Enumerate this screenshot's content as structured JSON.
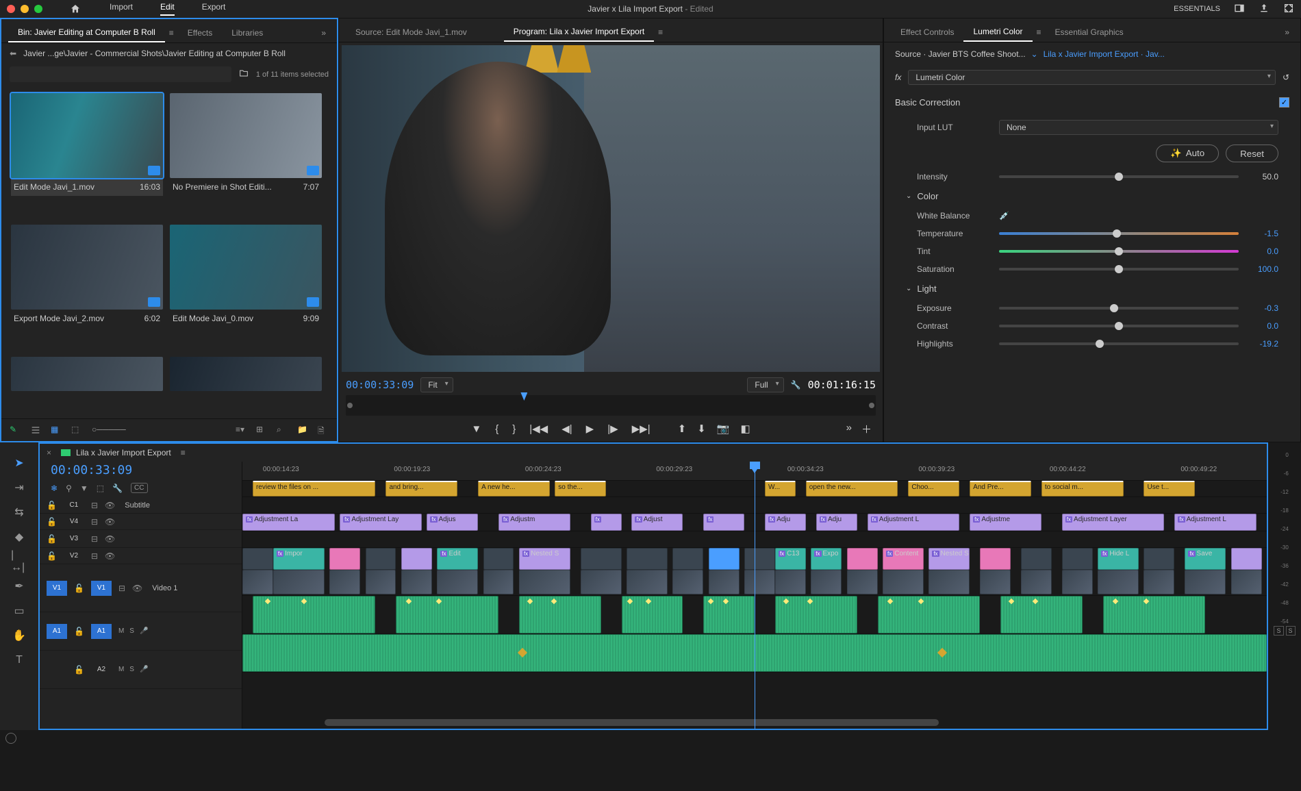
{
  "app": {
    "title": "Javier x Lila Import Export",
    "title_suffix": " - Edited",
    "modes": [
      "Import",
      "Edit",
      "Export"
    ],
    "active_mode": "Edit",
    "workspace": "ESSENTIALS"
  },
  "project": {
    "bin_tab": "Bin: Javier Editing at Computer B Roll",
    "tabs": [
      "Effects",
      "Libraries"
    ],
    "breadcrumb": "Javier ...ge\\Javier - Commercial Shots\\Javier Editing at Computer B Roll",
    "search_placeholder": "",
    "item_count": "1 of 11 items selected",
    "clips": [
      {
        "name": "Edit Mode Javi_1.mov",
        "dur": "16:03",
        "selected": true
      },
      {
        "name": "No Premiere in Shot Editi...",
        "dur": "7:07",
        "selected": false
      },
      {
        "name": "Export Mode Javi_2.mov",
        "dur": "6:02",
        "selected": false
      },
      {
        "name": "Edit Mode Javi_0.mov",
        "dur": "9:09",
        "selected": false
      }
    ]
  },
  "source": {
    "tab": "Source: Edit Mode Javi_1.mov"
  },
  "program": {
    "tab": "Program: Lila x Javier Import Export",
    "tc_in": "00:00:33:09",
    "tc_out": "00:01:16:15",
    "fit": "Fit",
    "zoom": "Full"
  },
  "lumetri": {
    "tabs": [
      "Effect Controls",
      "Lumetri Color",
      "Essential Graphics"
    ],
    "active": "Lumetri Color",
    "source": "Source · Javier BTS Coffee Shoot...",
    "seq_link": "Lila x Javier Import Export · Jav...",
    "effect_name": "Lumetri Color",
    "basic_correction": "Basic Correction",
    "input_lut_label": "Input LUT",
    "input_lut_value": "None",
    "auto": "Auto",
    "reset": "Reset",
    "intensity": {
      "label": "Intensity",
      "value": "50.0",
      "pos": 50
    },
    "color_section": "Color",
    "white_balance": "White Balance",
    "sliders": [
      {
        "label": "Temperature",
        "value": "-1.5",
        "pos": 49,
        "cls": "temp"
      },
      {
        "label": "Tint",
        "value": "0.0",
        "pos": 50,
        "cls": "tint"
      },
      {
        "label": "Saturation",
        "value": "100.0",
        "pos": 50,
        "cls": ""
      }
    ],
    "light_section": "Light",
    "light_sliders": [
      {
        "label": "Exposure",
        "value": "-0.3",
        "pos": 48
      },
      {
        "label": "Contrast",
        "value": "0.0",
        "pos": 50
      },
      {
        "label": "Highlights",
        "value": "-19.2",
        "pos": 42
      }
    ]
  },
  "sequence": {
    "name": "Lila x Javier Import Export",
    "timecode": "00:00:33:09",
    "ruler_ticks": [
      "00:00:14:23",
      "00:00:19:23",
      "00:00:24:23",
      "00:00:29:23",
      "00:00:34:23",
      "00:00:39:23",
      "00:00:44:22",
      "00:00:49:22"
    ],
    "playhead_pct": 50,
    "tracks_v": [
      {
        "id": "C1",
        "name": "Subtitle"
      },
      {
        "id": "V4",
        "name": ""
      },
      {
        "id": "V3",
        "name": ""
      },
      {
        "id": "V2",
        "name": ""
      },
      {
        "id": "V1",
        "name": "Video 1",
        "src": true
      }
    ],
    "tracks_a": [
      {
        "id": "A1",
        "name": "",
        "src": true
      },
      {
        "id": "A2",
        "name": ""
      }
    ],
    "captions": [
      {
        "l": 1,
        "w": 12,
        "t": "review the files on ..."
      },
      {
        "l": 14,
        "w": 7,
        "t": "and bring..."
      },
      {
        "l": 23,
        "w": 7,
        "t": "A new he..."
      },
      {
        "l": 30.5,
        "w": 5,
        "t": "so the..."
      },
      {
        "l": 51,
        "w": 3,
        "t": "W..."
      },
      {
        "l": 55,
        "w": 9,
        "t": "open the new..."
      },
      {
        "l": 65,
        "w": 5,
        "t": "Choo..."
      },
      {
        "l": 71,
        "w": 6,
        "t": "And Pre..."
      },
      {
        "l": 78,
        "w": 8,
        "t": "to social m..."
      },
      {
        "l": 88,
        "w": 5,
        "t": "Use t..."
      }
    ],
    "v3_clips": [
      {
        "l": 0,
        "w": 9,
        "t": "Adjustment La"
      },
      {
        "l": 9.5,
        "w": 8,
        "t": "Adjustment Lay"
      },
      {
        "l": 18,
        "w": 5,
        "t": "Adjus"
      },
      {
        "l": 25,
        "w": 7,
        "t": "Adjustm"
      },
      {
        "l": 34,
        "w": 3,
        "t": ""
      },
      {
        "l": 38,
        "w": 5,
        "t": "Adjust"
      },
      {
        "l": 45,
        "w": 4,
        "t": ""
      },
      {
        "l": 51,
        "w": 4,
        "t": "Adju"
      },
      {
        "l": 56,
        "w": 4,
        "t": "Adju"
      },
      {
        "l": 61,
        "w": 9,
        "t": "Adjustment L"
      },
      {
        "l": 71,
        "w": 7,
        "t": "Adjustme"
      },
      {
        "l": 80,
        "w": 10,
        "t": "Adjustment Layer"
      },
      {
        "l": 91,
        "w": 8,
        "t": "Adjustment L"
      }
    ],
    "v1_clips": [
      {
        "l": 0,
        "w": 3,
        "cls": "vid"
      },
      {
        "l": 3,
        "w": 5,
        "cls": "teal",
        "t": "Impor"
      },
      {
        "l": 8.5,
        "w": 3,
        "cls": "pink"
      },
      {
        "l": 12,
        "w": 3,
        "cls": "vid"
      },
      {
        "l": 15.5,
        "w": 3,
        "cls": "purple"
      },
      {
        "l": 19,
        "w": 4,
        "cls": "teal",
        "t": "Edit"
      },
      {
        "l": 23.5,
        "w": 3,
        "cls": "vid"
      },
      {
        "l": 27,
        "w": 5,
        "cls": "purple",
        "t": "Nested S"
      },
      {
        "l": 33,
        "w": 4,
        "cls": "vid"
      },
      {
        "l": 37.5,
        "w": 4,
        "cls": "vid"
      },
      {
        "l": 42,
        "w": 3,
        "cls": "vid"
      },
      {
        "l": 45.5,
        "w": 3,
        "cls": "blue"
      },
      {
        "l": 49,
        "w": 3,
        "cls": "vid"
      },
      {
        "l": 52,
        "w": 3,
        "cls": "teal",
        "t": "C13"
      },
      {
        "l": 55.5,
        "w": 3,
        "cls": "teal",
        "t": "Expo"
      },
      {
        "l": 59,
        "w": 3,
        "cls": "pink"
      },
      {
        "l": 62.5,
        "w": 4,
        "cls": "pink",
        "t": "Content"
      },
      {
        "l": 67,
        "w": 4,
        "cls": "purple",
        "t": "Nested S"
      },
      {
        "l": 72,
        "w": 3,
        "cls": "pink"
      },
      {
        "l": 76,
        "w": 3,
        "cls": "vid"
      },
      {
        "l": 80,
        "w": 3,
        "cls": "vid"
      },
      {
        "l": 83.5,
        "w": 4,
        "cls": "teal",
        "t": "Hide L"
      },
      {
        "l": 88,
        "w": 3,
        "cls": "vid"
      },
      {
        "l": 92,
        "w": 4,
        "cls": "teal",
        "t": "Save"
      },
      {
        "l": 96.5,
        "w": 3,
        "cls": "purple"
      }
    ]
  },
  "meters": {
    "scale": [
      "0",
      "-6",
      "-12",
      "-18",
      "-24",
      "-30",
      "-36",
      "-42",
      "-48",
      "-54"
    ]
  }
}
